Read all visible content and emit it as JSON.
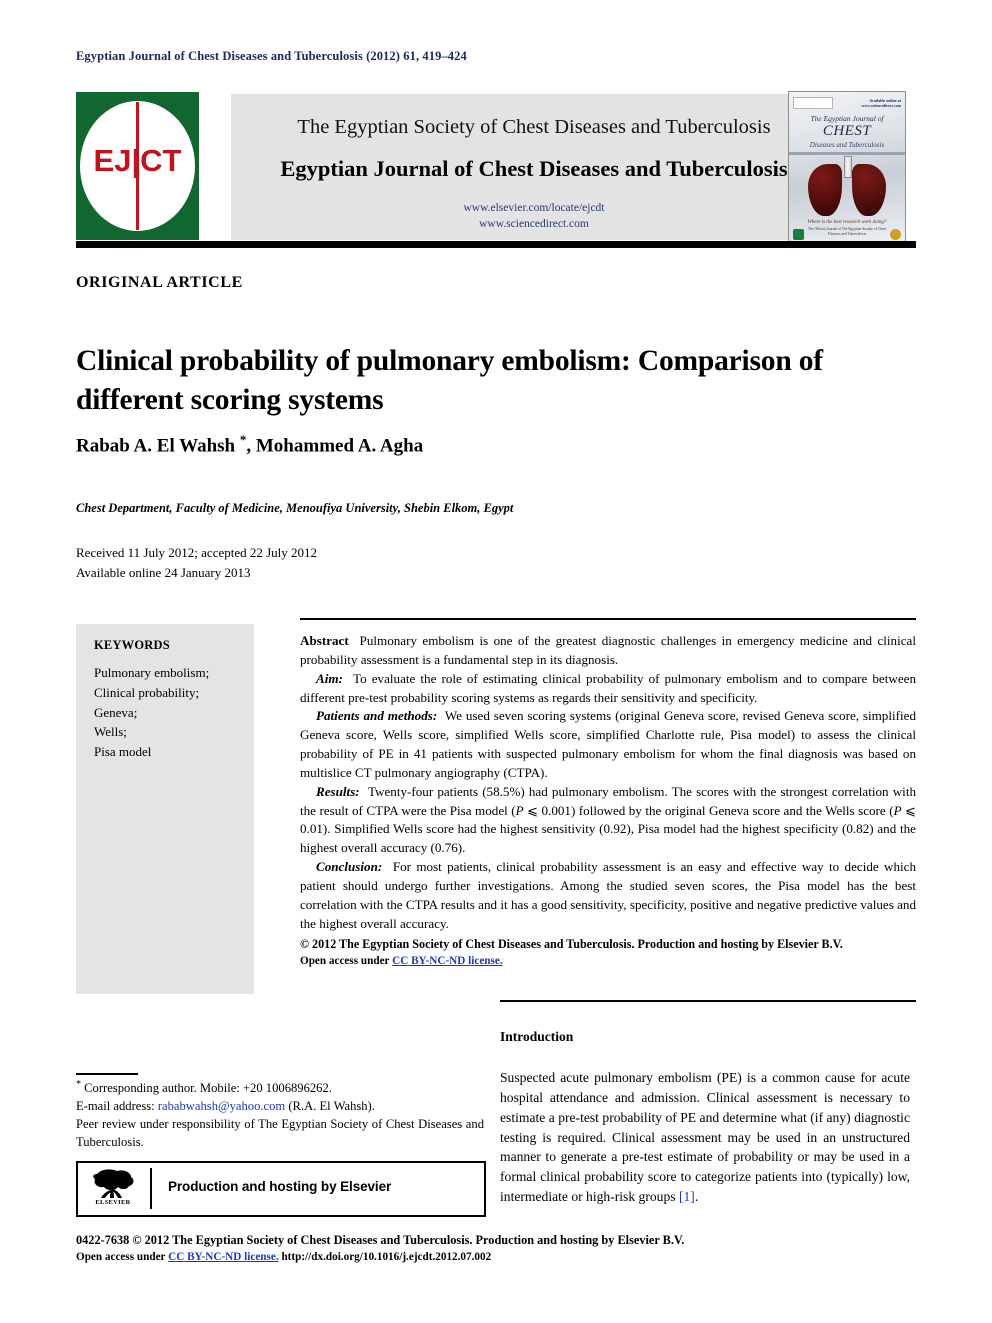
{
  "running_head": "Egyptian Journal of Chest Diseases and Tuberculosis (2012) 61, 419–424",
  "masthead": {
    "logo_text": "EJ|CT",
    "society_line": "The Egyptian Society of Chest Diseases and Tuberculosis",
    "journal_line": "Egyptian Journal of Chest Diseases and Tuberculosis",
    "url_elsevier": "www.elsevier.com/locate/ejcdt",
    "url_sciencedirect": "www.sciencedirect.com",
    "cover": {
      "top_right": "Available online at www.sciencedirect.com",
      "line1": "The Egyptian Journal of",
      "line2": "CHEST",
      "line3": "Diseases and Tuberculosis",
      "bottom_italic": "Where is the best research work doing?",
      "bottom_small": "The Official Journal of The Egyptian Society of Chest Diseases and Tuberculosis"
    }
  },
  "article": {
    "type_label": "ORIGINAL ARTICLE",
    "title": "Clinical probability of pulmonary embolism: Comparison of different scoring systems",
    "authors": "Rabab A. El Wahsh ",
    "authors_rest": ", Mohammed A. Agha",
    "corresponding_marker": "*",
    "affiliation": "Chest Department, Faculty of Medicine, Menoufiya University, Shebin Elkom, Egypt",
    "received": "Received 11 July 2012; accepted 22 July 2012",
    "available": "Available online 24 January 2013"
  },
  "keywords": {
    "heading": "KEYWORDS",
    "items": [
      "Pulmonary embolism;",
      "Clinical probability;",
      "Geneva;",
      "Wells;",
      "Pisa model"
    ]
  },
  "abstract": {
    "label": "Abstract",
    "lead": "Pulmonary embolism is one of the greatest diagnostic challenges in emergency medicine and clinical probability assessment is a fundamental step in its diagnosis.",
    "aim_label": "Aim:",
    "aim": "To evaluate the role of estimating clinical probability of pulmonary embolism and to compare between different pre-test probability scoring systems as regards their sensitivity and specificity.",
    "methods_label": "Patients and methods:",
    "methods": "We used seven scoring systems (original Geneva score, revised Geneva score, simplified Geneva score, Wells score, simplified Wells score, simplified Charlotte rule, Pisa model) to assess the clinical probability of PE in 41 patients with suspected pulmonary embolism for whom the final diagnosis was based on multislice CT pulmonary angiography (CTPA).",
    "results_label": "Results:",
    "results_a": "Twenty-four patients (58.5%) had pulmonary embolism. The scores with the strongest correlation with the result of CTPA were the Pisa model (",
    "results_p1": "P",
    "results_b": " ⩽ 0.001) followed by the original Geneva score and the Wells score (",
    "results_p2": "P",
    "results_c": " ⩽ 0.01). Simplified Wells score had the highest sensitivity (0.92), Pisa model had the highest specificity (0.82) and the highest overall accuracy (0.76).",
    "conclusion_label": "Conclusion:",
    "conclusion": "For most patients, clinical probability assessment is an easy and effective way to decide which patient should undergo further investigations. Among the studied seven scores, the Pisa model has the best correlation with the CTPA results and it has a good sensitivity, specificity, positive and negative predictive values and the highest overall accuracy.",
    "copyright": "© 2012 The Egyptian Society of Chest Diseases and Tuberculosis. Production and hosting by Elsevier B.V.",
    "open_access_prefix": "Open access under ",
    "open_access_link": "CC BY-NC-ND license."
  },
  "footnote": {
    "corresponding": " Corresponding author. Mobile: +20 1006896262.",
    "email_label": "E-mail address: ",
    "email": "rababwahsh@yahoo.com",
    "email_suffix": " (R.A. El Wahsh).",
    "peer_review": "Peer review under responsibility of The Egyptian Society of Chest Diseases and Tuberculosis."
  },
  "elsevier_box": {
    "wordmark": "ELSEVIER",
    "text": "Production and hosting by Elsevier"
  },
  "introduction": {
    "heading": "Introduction",
    "paragraph_a": "Suspected acute pulmonary embolism (PE) is a common cause for acute hospital attendance and admission. Clinical assessment is necessary to estimate a pre-test probability of PE and determine what (if any) diagnostic testing is required. Clinical assessment may be used in an unstructured manner to generate a pre-test estimate of probability or may be used in a formal clinical probability score to categorize patients into (typically) low, intermediate or high-risk groups ",
    "ref": "[1]",
    "paragraph_b": "."
  },
  "bottom": {
    "line1": "0422-7638 © 2012 The Egyptian Society of Chest Diseases and Tuberculosis. Production and hosting by Elsevier B.V.",
    "line2_prefix": "Open access under ",
    "line2_link": "CC BY-NC-ND license.",
    "line2_doi": " http://dx.doi.org/10.1016/j.ejcdt.2012.07.002"
  },
  "colors": {
    "running_head": "#17295e",
    "logo_green": "#12662f",
    "logo_red": "#c1121f",
    "banner_gray": "#e3e3e3",
    "link_blue": "#1a37c8",
    "url_navy": "#2b3a77",
    "keywords_gray": "#e4e4e4"
  }
}
